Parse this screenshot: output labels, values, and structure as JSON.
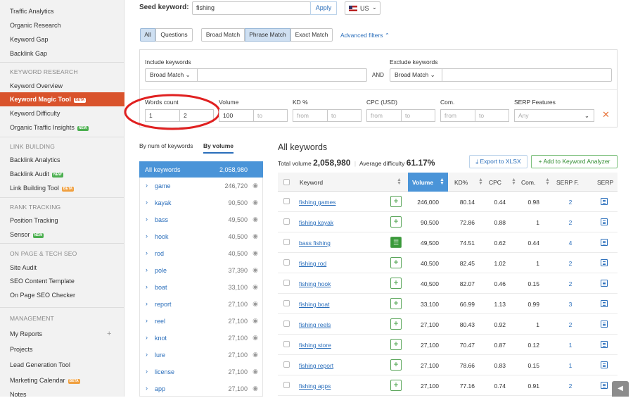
{
  "sidebar": {
    "top_items": [
      "Traffic Analytics",
      "Organic Research",
      "Keyword Gap",
      "Backlink Gap"
    ],
    "kr_header": "KEYWORD RESEARCH",
    "kr_items": [
      {
        "label": "Keyword Overview"
      },
      {
        "label": "Keyword Magic Tool",
        "badge": "BETA"
      },
      {
        "label": "Keyword Difficulty"
      },
      {
        "label": "Organic Traffic Insights",
        "badge": "NEW"
      }
    ],
    "lb_header": "LINK BUILDING",
    "lb_items": [
      {
        "label": "Backlink Analytics"
      },
      {
        "label": "Backlink Audit",
        "badge": "NEW"
      },
      {
        "label": "Link Building Tool",
        "badge": "BETA"
      }
    ],
    "rt_header": "RANK TRACKING",
    "rt_items": [
      {
        "label": "Position Tracking"
      },
      {
        "label": "Sensor",
        "badge": "NEW"
      }
    ],
    "op_header": "ON PAGE & TECH SEO",
    "op_items": [
      "Site Audit",
      "SEO Content Template",
      "On Page SEO Checker"
    ],
    "mg_header": "MANAGEMENT",
    "mg_items": [
      {
        "label": "My Reports"
      },
      {
        "label": "Projects"
      },
      {
        "label": "Lead Generation Tool"
      },
      {
        "label": "Marketing Calendar",
        "badge": "BETA"
      },
      {
        "label": "Notes"
      }
    ]
  },
  "search": {
    "label": "Seed keyword:",
    "value": "fishing",
    "apply": "Apply",
    "country": "US"
  },
  "match_tabs": [
    "All",
    "Questions"
  ],
  "match_types": [
    "Broad Match",
    "Phrase Match",
    "Exact Match"
  ],
  "advanced_filters": "Advanced filters",
  "filters": {
    "include_label": "Include keywords",
    "include_match": "Broad Match",
    "and": "AND",
    "exclude_label": "Exclude keywords",
    "exclude_match": "Broad Match",
    "words_count_label": "Words count",
    "words_from": "1",
    "words_to": "2",
    "volume_label": "Volume",
    "volume_from": "100",
    "kd_label": "KD %",
    "cpc_label": "CPC (USD)",
    "com_label": "Com.",
    "serp_label": "SERP Features",
    "serp_value": "Any",
    "ph_from": "from",
    "ph_to": "to"
  },
  "left_tabs": [
    "By num of keywords",
    "By volume"
  ],
  "groups_all": {
    "label": "All keywords",
    "count": "2,058,980"
  },
  "groups": [
    {
      "name": "game",
      "count": "246,720"
    },
    {
      "name": "kayak",
      "count": "90,500"
    },
    {
      "name": "bass",
      "count": "49,500"
    },
    {
      "name": "hook",
      "count": "40,500"
    },
    {
      "name": "rod",
      "count": "40,500"
    },
    {
      "name": "pole",
      "count": "37,390"
    },
    {
      "name": "boat",
      "count": "33,100"
    },
    {
      "name": "report",
      "count": "27,100"
    },
    {
      "name": "reel",
      "count": "27,100"
    },
    {
      "name": "knot",
      "count": "27,100"
    },
    {
      "name": "lure",
      "count": "27,100"
    },
    {
      "name": "license",
      "count": "27,100"
    },
    {
      "name": "app",
      "count": "27,100"
    }
  ],
  "results": {
    "title": "All keywords",
    "total_label": "Total volume",
    "total_value": "2,058,980",
    "diff_label": "Average difficulty",
    "diff_value": "61.17%",
    "export": "Export to XLSX",
    "add_analyzer": "Add to Keyword Analyzer"
  },
  "columns": [
    "Keyword",
    "Volume",
    "KD%",
    "CPC",
    "Com.",
    "SERP F.",
    "SERP"
  ],
  "rows": [
    {
      "kw": "fishing games",
      "vol": "246,000",
      "kd": "80.14",
      "cpc": "0.44",
      "com": "0.98",
      "serp": "2",
      "added": false
    },
    {
      "kw": "fishing kayak",
      "vol": "90,500",
      "kd": "72.86",
      "cpc": "0.88",
      "com": "1",
      "serp": "2",
      "added": false
    },
    {
      "kw": "bass fishing",
      "vol": "49,500",
      "kd": "74.51",
      "cpc": "0.62",
      "com": "0.44",
      "serp": "4",
      "added": true
    },
    {
      "kw": "fishing rod",
      "vol": "40,500",
      "kd": "82.45",
      "cpc": "1.02",
      "com": "1",
      "serp": "2",
      "added": false
    },
    {
      "kw": "fishing hook",
      "vol": "40,500",
      "kd": "82.07",
      "cpc": "0.46",
      "com": "0.15",
      "serp": "2",
      "added": false
    },
    {
      "kw": "fishing boat",
      "vol": "33,100",
      "kd": "66.99",
      "cpc": "1.13",
      "com": "0.99",
      "serp": "3",
      "added": false
    },
    {
      "kw": "fishing reels",
      "vol": "27,100",
      "kd": "80.43",
      "cpc": "0.92",
      "com": "1",
      "serp": "2",
      "added": false
    },
    {
      "kw": "fishing store",
      "vol": "27,100",
      "kd": "70.47",
      "cpc": "0.87",
      "com": "0.12",
      "serp": "1",
      "added": false
    },
    {
      "kw": "fishing report",
      "vol": "27,100",
      "kd": "78.66",
      "cpc": "0.83",
      "com": "0.15",
      "serp": "1",
      "added": false
    },
    {
      "kw": "fishing apps",
      "vol": "27,100",
      "kd": "77.16",
      "cpc": "0.74",
      "com": "0.91",
      "serp": "2",
      "added": false
    }
  ],
  "colors": {
    "accent": "#d9532c",
    "link": "#2a6ebb",
    "highlight": "#4a94d8",
    "annotation": "#e02020"
  }
}
